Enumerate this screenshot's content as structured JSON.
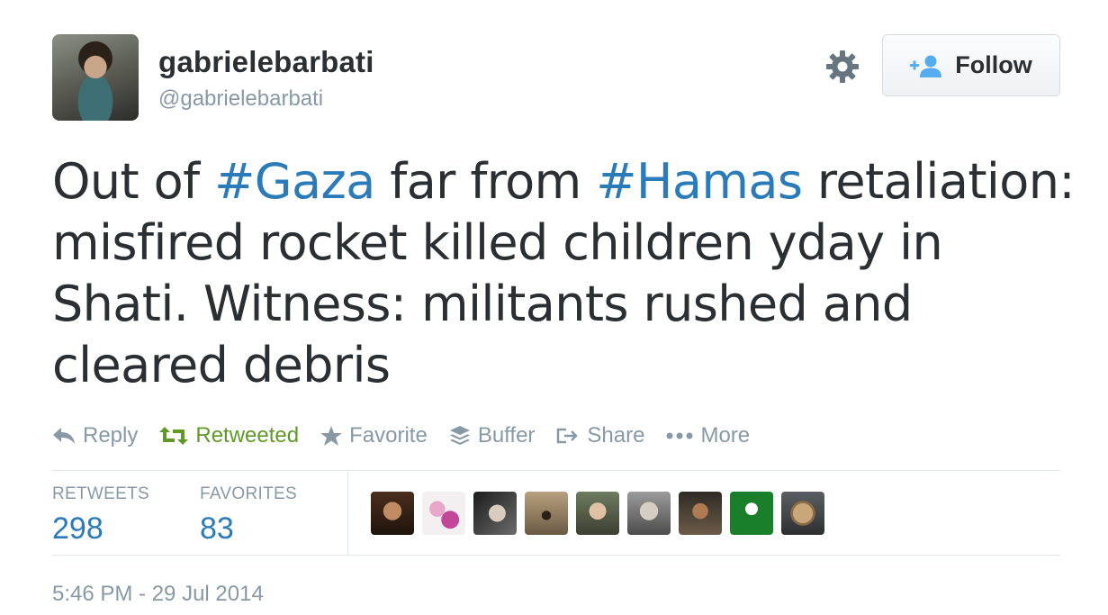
{
  "user": {
    "display_name": "gabrielebarbati",
    "screen_name": "@gabrielebarbati"
  },
  "header": {
    "follow_label": "Follow",
    "gear_icon": "gear-icon"
  },
  "tweet": {
    "segments": [
      {
        "text": "Out of ",
        "type": "text"
      },
      {
        "text": "#Gaza",
        "type": "hashtag"
      },
      {
        "text": " far from ",
        "type": "text"
      },
      {
        "text": "#Hamas",
        "type": "hashtag"
      },
      {
        "text": " retaliation: misfired rocket killed children yday in Shati. Witness: militants rushed and cleared debris",
        "type": "text"
      }
    ]
  },
  "actions": [
    {
      "label": "Reply",
      "icon": "reply-icon"
    },
    {
      "label": "Retweeted",
      "icon": "retweet-icon"
    },
    {
      "label": "Favorite",
      "icon": "star-icon"
    },
    {
      "label": "Buffer",
      "icon": "buffer-icon"
    },
    {
      "label": "Share",
      "icon": "share-icon"
    },
    {
      "label": "More",
      "icon": "more-icon"
    }
  ],
  "stats": {
    "retweets_label": "RETWEETS",
    "retweets_value": "298",
    "favorites_label": "FAVORITES",
    "favorites_value": "83"
  },
  "timestamp": "5:46 PM - 29 Jul 2014",
  "colors": {
    "link": "#2b7bb9",
    "muted": "#8899a6",
    "retweeted": "#609928",
    "text": "#292f33"
  }
}
